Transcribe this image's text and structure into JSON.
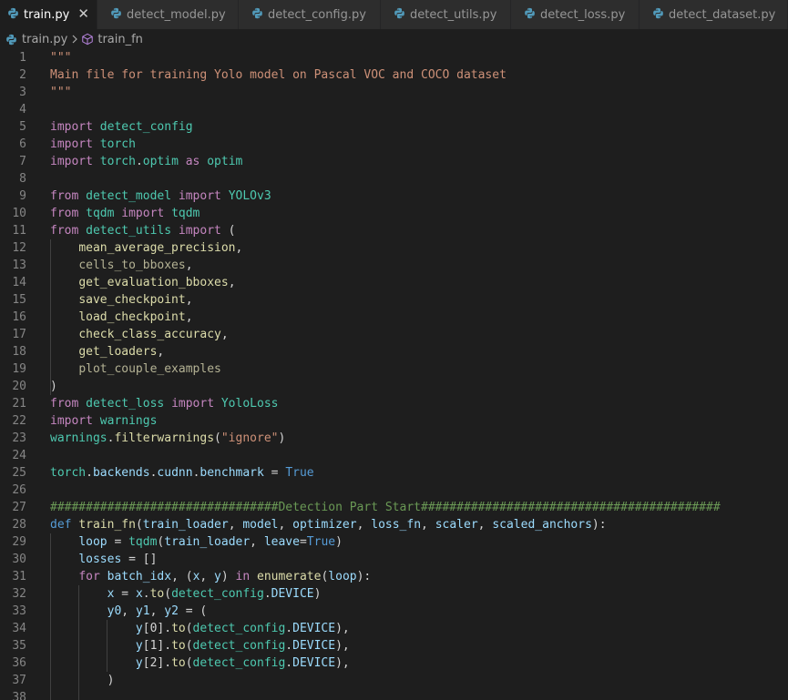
{
  "tabs": [
    {
      "label": "train.py",
      "active": true
    },
    {
      "label": "detect_model.py",
      "active": false
    },
    {
      "label": "detect_config.py",
      "active": false
    },
    {
      "label": "detect_utils.py",
      "active": false
    },
    {
      "label": "detect_loss.py",
      "active": false
    },
    {
      "label": "detect_dataset.py",
      "active": false
    }
  ],
  "tab_close_glyph": "✕",
  "breadcrumb": {
    "file": "train.py",
    "symbol": "train_fn"
  },
  "colors": {
    "editor_bg": "#1e1e1e",
    "tab_bar": "#252526",
    "tab_inactive": "#2d2d2d",
    "python_icon": "#519aba",
    "symbol_icon": "#b180d7"
  },
  "code_lines": [
    {
      "n": "1",
      "tokens": [
        {
          "t": "\"\"\"",
          "c": "str"
        }
      ]
    },
    {
      "n": "2",
      "tokens": [
        {
          "t": "Main file for training Yolo model on Pascal VOC and COCO dataset",
          "c": "str"
        }
      ]
    },
    {
      "n": "3",
      "tokens": [
        {
          "t": "\"\"\"",
          "c": "str"
        }
      ]
    },
    {
      "n": "4",
      "tokens": []
    },
    {
      "n": "5",
      "tokens": [
        {
          "t": "import",
          "c": "kw"
        },
        {
          "t": " ",
          "c": "p"
        },
        {
          "t": "detect_config",
          "c": "mod"
        }
      ]
    },
    {
      "n": "6",
      "tokens": [
        {
          "t": "import",
          "c": "kw"
        },
        {
          "t": " ",
          "c": "p"
        },
        {
          "t": "torch",
          "c": "mod"
        }
      ]
    },
    {
      "n": "7",
      "tokens": [
        {
          "t": "import",
          "c": "kw"
        },
        {
          "t": " ",
          "c": "p"
        },
        {
          "t": "torch",
          "c": "mod"
        },
        {
          "t": ".",
          "c": "p"
        },
        {
          "t": "optim",
          "c": "mod"
        },
        {
          "t": " ",
          "c": "p"
        },
        {
          "t": "as",
          "c": "kw"
        },
        {
          "t": " ",
          "c": "p"
        },
        {
          "t": "optim",
          "c": "mod"
        }
      ]
    },
    {
      "n": "8",
      "tokens": []
    },
    {
      "n": "9",
      "tokens": [
        {
          "t": "from",
          "c": "kw"
        },
        {
          "t": " ",
          "c": "p"
        },
        {
          "t": "detect_model",
          "c": "mod"
        },
        {
          "t": " ",
          "c": "p"
        },
        {
          "t": "import",
          "c": "kw"
        },
        {
          "t": " ",
          "c": "p"
        },
        {
          "t": "YOLOv3",
          "c": "mod"
        }
      ]
    },
    {
      "n": "10",
      "tokens": [
        {
          "t": "from",
          "c": "kw"
        },
        {
          "t": " ",
          "c": "p"
        },
        {
          "t": "tqdm",
          "c": "mod"
        },
        {
          "t": " ",
          "c": "p"
        },
        {
          "t": "import",
          "c": "kw"
        },
        {
          "t": " ",
          "c": "p"
        },
        {
          "t": "tqdm",
          "c": "mod"
        }
      ]
    },
    {
      "n": "11",
      "tokens": [
        {
          "t": "from",
          "c": "kw"
        },
        {
          "t": " ",
          "c": "p"
        },
        {
          "t": "detect_utils",
          "c": "mod"
        },
        {
          "t": " ",
          "c": "p"
        },
        {
          "t": "import",
          "c": "kw"
        },
        {
          "t": " (",
          "c": "p"
        }
      ]
    },
    {
      "n": "12",
      "tokens": [
        {
          "t": "    ",
          "c": "p"
        },
        {
          "t": "mean_average_precision",
          "c": "fn"
        },
        {
          "t": ",",
          "c": "p"
        }
      ]
    },
    {
      "n": "13",
      "tokens": [
        {
          "t": "    ",
          "c": "p"
        },
        {
          "t": "cells_to_bboxes",
          "c": "dim"
        },
        {
          "t": ",",
          "c": "p"
        }
      ]
    },
    {
      "n": "14",
      "tokens": [
        {
          "t": "    ",
          "c": "p"
        },
        {
          "t": "get_evaluation_bboxes",
          "c": "fn"
        },
        {
          "t": ",",
          "c": "p"
        }
      ]
    },
    {
      "n": "15",
      "tokens": [
        {
          "t": "    ",
          "c": "p"
        },
        {
          "t": "save_checkpoint",
          "c": "fn"
        },
        {
          "t": ",",
          "c": "p"
        }
      ]
    },
    {
      "n": "16",
      "tokens": [
        {
          "t": "    ",
          "c": "p"
        },
        {
          "t": "load_checkpoint",
          "c": "fn"
        },
        {
          "t": ",",
          "c": "p"
        }
      ]
    },
    {
      "n": "17",
      "tokens": [
        {
          "t": "    ",
          "c": "p"
        },
        {
          "t": "check_class_accuracy",
          "c": "fn"
        },
        {
          "t": ",",
          "c": "p"
        }
      ]
    },
    {
      "n": "18",
      "tokens": [
        {
          "t": "    ",
          "c": "p"
        },
        {
          "t": "get_loaders",
          "c": "fn"
        },
        {
          "t": ",",
          "c": "p"
        }
      ]
    },
    {
      "n": "19",
      "tokens": [
        {
          "t": "    ",
          "c": "p"
        },
        {
          "t": "plot_couple_examples",
          "c": "dim"
        }
      ]
    },
    {
      "n": "20",
      "tokens": [
        {
          "t": ")",
          "c": "p"
        }
      ]
    },
    {
      "n": "21",
      "tokens": [
        {
          "t": "from",
          "c": "kw"
        },
        {
          "t": " ",
          "c": "p"
        },
        {
          "t": "detect_loss",
          "c": "mod"
        },
        {
          "t": " ",
          "c": "p"
        },
        {
          "t": "import",
          "c": "kw"
        },
        {
          "t": " ",
          "c": "p"
        },
        {
          "t": "YoloLoss",
          "c": "mod"
        }
      ]
    },
    {
      "n": "22",
      "tokens": [
        {
          "t": "import",
          "c": "kw"
        },
        {
          "t": " ",
          "c": "p"
        },
        {
          "t": "warnings",
          "c": "mod"
        }
      ]
    },
    {
      "n": "23",
      "tokens": [
        {
          "t": "warnings",
          "c": "mod"
        },
        {
          "t": ".",
          "c": "p"
        },
        {
          "t": "filterwarnings",
          "c": "fn"
        },
        {
          "t": "(",
          "c": "p"
        },
        {
          "t": "\"ignore\"",
          "c": "str"
        },
        {
          "t": ")",
          "c": "p"
        }
      ]
    },
    {
      "n": "24",
      "tokens": []
    },
    {
      "n": "25",
      "tokens": [
        {
          "t": "torch",
          "c": "mod"
        },
        {
          "t": ".",
          "c": "p"
        },
        {
          "t": "backends",
          "c": "var"
        },
        {
          "t": ".",
          "c": "p"
        },
        {
          "t": "cudnn",
          "c": "var"
        },
        {
          "t": ".",
          "c": "p"
        },
        {
          "t": "benchmark",
          "c": "var"
        },
        {
          "t": " = ",
          "c": "p"
        },
        {
          "t": "True",
          "c": "const"
        }
      ]
    },
    {
      "n": "26",
      "tokens": []
    },
    {
      "n": "27",
      "tokens": [
        {
          "t": "################################Detection Part Start##########################################",
          "c": "cmt"
        }
      ]
    },
    {
      "n": "28",
      "tokens": [
        {
          "t": "def",
          "c": "def"
        },
        {
          "t": " ",
          "c": "p"
        },
        {
          "t": "train_fn",
          "c": "fn"
        },
        {
          "t": "(",
          "c": "p"
        },
        {
          "t": "train_loader",
          "c": "var"
        },
        {
          "t": ", ",
          "c": "p"
        },
        {
          "t": "model",
          "c": "var"
        },
        {
          "t": ", ",
          "c": "p"
        },
        {
          "t": "optimizer",
          "c": "var"
        },
        {
          "t": ", ",
          "c": "p"
        },
        {
          "t": "loss_fn",
          "c": "var"
        },
        {
          "t": ", ",
          "c": "p"
        },
        {
          "t": "scaler",
          "c": "var"
        },
        {
          "t": ", ",
          "c": "p"
        },
        {
          "t": "scaled_anchors",
          "c": "var"
        },
        {
          "t": "):",
          "c": "p"
        }
      ]
    },
    {
      "n": "29",
      "tokens": [
        {
          "t": "    ",
          "c": "p"
        },
        {
          "t": "loop",
          "c": "var"
        },
        {
          "t": " = ",
          "c": "p"
        },
        {
          "t": "tqdm",
          "c": "mod"
        },
        {
          "t": "(",
          "c": "p"
        },
        {
          "t": "train_loader",
          "c": "var"
        },
        {
          "t": ", ",
          "c": "p"
        },
        {
          "t": "leave",
          "c": "var"
        },
        {
          "t": "=",
          "c": "p"
        },
        {
          "t": "True",
          "c": "const"
        },
        {
          "t": ")",
          "c": "p"
        }
      ]
    },
    {
      "n": "30",
      "tokens": [
        {
          "t": "    ",
          "c": "p"
        },
        {
          "t": "losses",
          "c": "var"
        },
        {
          "t": " = []",
          "c": "p"
        }
      ]
    },
    {
      "n": "31",
      "tokens": [
        {
          "t": "    ",
          "c": "p"
        },
        {
          "t": "for",
          "c": "kw"
        },
        {
          "t": " ",
          "c": "p"
        },
        {
          "t": "batch_idx",
          "c": "var"
        },
        {
          "t": ", (",
          "c": "p"
        },
        {
          "t": "x",
          "c": "var"
        },
        {
          "t": ", ",
          "c": "p"
        },
        {
          "t": "y",
          "c": "var"
        },
        {
          "t": ") ",
          "c": "p"
        },
        {
          "t": "in",
          "c": "kw"
        },
        {
          "t": " ",
          "c": "p"
        },
        {
          "t": "enumerate",
          "c": "fn"
        },
        {
          "t": "(",
          "c": "p"
        },
        {
          "t": "loop",
          "c": "var"
        },
        {
          "t": "):",
          "c": "p"
        }
      ]
    },
    {
      "n": "32",
      "tokens": [
        {
          "t": "        ",
          "c": "p"
        },
        {
          "t": "x",
          "c": "var"
        },
        {
          "t": " = ",
          "c": "p"
        },
        {
          "t": "x",
          "c": "var"
        },
        {
          "t": ".",
          "c": "p"
        },
        {
          "t": "to",
          "c": "fn"
        },
        {
          "t": "(",
          "c": "p"
        },
        {
          "t": "detect_config",
          "c": "mod"
        },
        {
          "t": ".",
          "c": "p"
        },
        {
          "t": "DEVICE",
          "c": "var"
        },
        {
          "t": ")",
          "c": "p"
        }
      ]
    },
    {
      "n": "33",
      "tokens": [
        {
          "t": "        ",
          "c": "p"
        },
        {
          "t": "y0",
          "c": "var"
        },
        {
          "t": ", ",
          "c": "p"
        },
        {
          "t": "y1",
          "c": "var"
        },
        {
          "t": ", ",
          "c": "p"
        },
        {
          "t": "y2",
          "c": "var"
        },
        {
          "t": " = (",
          "c": "p"
        }
      ]
    },
    {
      "n": "34",
      "tokens": [
        {
          "t": "            ",
          "c": "p"
        },
        {
          "t": "y",
          "c": "var"
        },
        {
          "t": "[0].",
          "c": "p"
        },
        {
          "t": "to",
          "c": "fn"
        },
        {
          "t": "(",
          "c": "p"
        },
        {
          "t": "detect_config",
          "c": "mod"
        },
        {
          "t": ".",
          "c": "p"
        },
        {
          "t": "DEVICE",
          "c": "var"
        },
        {
          "t": "),",
          "c": "p"
        }
      ]
    },
    {
      "n": "35",
      "tokens": [
        {
          "t": "            ",
          "c": "p"
        },
        {
          "t": "y",
          "c": "var"
        },
        {
          "t": "[1].",
          "c": "p"
        },
        {
          "t": "to",
          "c": "fn"
        },
        {
          "t": "(",
          "c": "p"
        },
        {
          "t": "detect_config",
          "c": "mod"
        },
        {
          "t": ".",
          "c": "p"
        },
        {
          "t": "DEVICE",
          "c": "var"
        },
        {
          "t": "),",
          "c": "p"
        }
      ]
    },
    {
      "n": "36",
      "tokens": [
        {
          "t": "            ",
          "c": "p"
        },
        {
          "t": "y",
          "c": "var"
        },
        {
          "t": "[2].",
          "c": "p"
        },
        {
          "t": "to",
          "c": "fn"
        },
        {
          "t": "(",
          "c": "p"
        },
        {
          "t": "detect_config",
          "c": "mod"
        },
        {
          "t": ".",
          "c": "p"
        },
        {
          "t": "DEVICE",
          "c": "var"
        },
        {
          "t": "),",
          "c": "p"
        }
      ]
    },
    {
      "n": "37",
      "tokens": [
        {
          "t": "        ",
          "c": "p"
        },
        {
          "t": ")",
          "c": "p"
        }
      ]
    },
    {
      "n": "38",
      "tokens": []
    }
  ]
}
